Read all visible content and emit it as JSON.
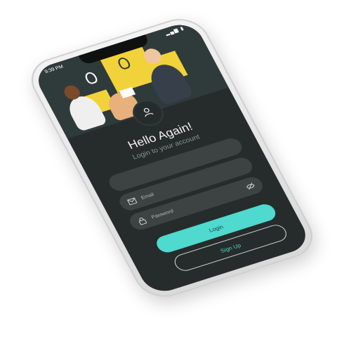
{
  "status_bar": {
    "time": "9:39 PM",
    "icons_text": "▂▄▆ ▮"
  },
  "header": {
    "illustration": "team-collaboration-illustration",
    "avatar_icon": "user-icon"
  },
  "login": {
    "title": "Hello Again!",
    "subtitle": "Login to your account",
    "email_placeholder": "Email",
    "password_placeholder": "Password",
    "login_label": "Login",
    "signup_label": "Sign Up"
  },
  "icons": {
    "email": "mail-icon",
    "password": "lock-icon",
    "toggle_visibility": "eye-off-icon"
  },
  "colors": {
    "screen_bg": "#262b2b",
    "field_bg": "#3c4342",
    "accent": "#4fd9cf",
    "illustration_yellow": "#f2d23a"
  }
}
